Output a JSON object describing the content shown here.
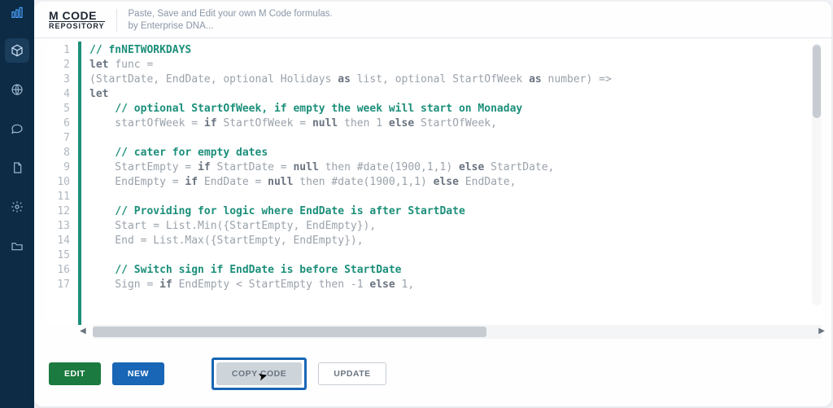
{
  "brand": {
    "top": "M CODE",
    "bottom": "REPOSITORY"
  },
  "tagline": {
    "line1": "Paste, Save and Edit your own M Code formulas.",
    "line2": "by Enterprise DNA..."
  },
  "code": {
    "lines": [
      {
        "n": 1,
        "seg": [
          {
            "t": "// fnNETWORKDAYS",
            "c": "cm"
          }
        ]
      },
      {
        "n": 2,
        "seg": [
          {
            "t": "let ",
            "c": "kw"
          },
          {
            "t": "func =",
            "c": "id"
          }
        ]
      },
      {
        "n": 3,
        "seg": [
          {
            "t": "(StartDate, EndDate, optional Holidays ",
            "c": "id"
          },
          {
            "t": "as",
            "c": "kw"
          },
          {
            "t": " list, optional StartOfWeek ",
            "c": "id"
          },
          {
            "t": "as",
            "c": "kw"
          },
          {
            "t": " number) =>",
            "c": "id"
          }
        ]
      },
      {
        "n": 4,
        "seg": [
          {
            "t": "let",
            "c": "kw"
          }
        ]
      },
      {
        "n": 5,
        "seg": [
          {
            "t": "    ",
            "c": "id"
          },
          {
            "t": "// optional StartOfWeek, if empty the week will start on Monaday",
            "c": "cm"
          }
        ]
      },
      {
        "n": 6,
        "seg": [
          {
            "t": "    startOfWeek = ",
            "c": "id"
          },
          {
            "t": "if",
            "c": "kw"
          },
          {
            "t": " StartOfWeek = ",
            "c": "id"
          },
          {
            "t": "null",
            "c": "kw"
          },
          {
            "t": " then 1 ",
            "c": "id"
          },
          {
            "t": "else",
            "c": "kw"
          },
          {
            "t": " StartOfWeek,",
            "c": "id"
          }
        ]
      },
      {
        "n": 7,
        "seg": [
          {
            "t": "",
            "c": "id"
          }
        ]
      },
      {
        "n": 8,
        "seg": [
          {
            "t": "    ",
            "c": "id"
          },
          {
            "t": "// cater for empty dates",
            "c": "cm"
          }
        ]
      },
      {
        "n": 9,
        "seg": [
          {
            "t": "    StartEmpty = ",
            "c": "id"
          },
          {
            "t": "if",
            "c": "kw"
          },
          {
            "t": " StartDate = ",
            "c": "id"
          },
          {
            "t": "null",
            "c": "kw"
          },
          {
            "t": " then #date(1900,1,1) ",
            "c": "id"
          },
          {
            "t": "else",
            "c": "kw"
          },
          {
            "t": " StartDate,",
            "c": "id"
          }
        ]
      },
      {
        "n": 10,
        "seg": [
          {
            "t": "    EndEmpty = ",
            "c": "id"
          },
          {
            "t": "if",
            "c": "kw"
          },
          {
            "t": " EndDate = ",
            "c": "id"
          },
          {
            "t": "null",
            "c": "kw"
          },
          {
            "t": " then #date(1900,1,1) ",
            "c": "id"
          },
          {
            "t": "else",
            "c": "kw"
          },
          {
            "t": " EndDate,",
            "c": "id"
          }
        ]
      },
      {
        "n": 11,
        "seg": [
          {
            "t": "",
            "c": "id"
          }
        ]
      },
      {
        "n": 12,
        "seg": [
          {
            "t": "    ",
            "c": "id"
          },
          {
            "t": "// Providing for logic where EndDate is after StartDate",
            "c": "cm"
          }
        ]
      },
      {
        "n": 13,
        "seg": [
          {
            "t": "    Start = List.Min({StartEmpty, EndEmpty}),",
            "c": "id"
          }
        ]
      },
      {
        "n": 14,
        "seg": [
          {
            "t": "    End = List.Max({StartEmpty, EndEmpty}),",
            "c": "id"
          }
        ]
      },
      {
        "n": 15,
        "seg": [
          {
            "t": "",
            "c": "id"
          }
        ]
      },
      {
        "n": 16,
        "seg": [
          {
            "t": "    ",
            "c": "id"
          },
          {
            "t": "// Switch sign if EndDate is before StartDate",
            "c": "cm"
          }
        ]
      },
      {
        "n": 17,
        "seg": [
          {
            "t": "    Sign = ",
            "c": "id"
          },
          {
            "t": "if",
            "c": "kw"
          },
          {
            "t": " EndEmpty < StartEmpty then -1 ",
            "c": "id"
          },
          {
            "t": "else",
            "c": "kw"
          },
          {
            "t": " 1,",
            "c": "id"
          }
        ]
      }
    ]
  },
  "hscroll": {
    "thumb_pct": 54
  },
  "buttons": {
    "edit": "EDIT",
    "new": "NEW",
    "copy": "COPY CODE",
    "update": "UPDATE"
  },
  "sidebar_icons": [
    "logo",
    "cube",
    "globe",
    "chat",
    "doc",
    "gear",
    "folder"
  ]
}
